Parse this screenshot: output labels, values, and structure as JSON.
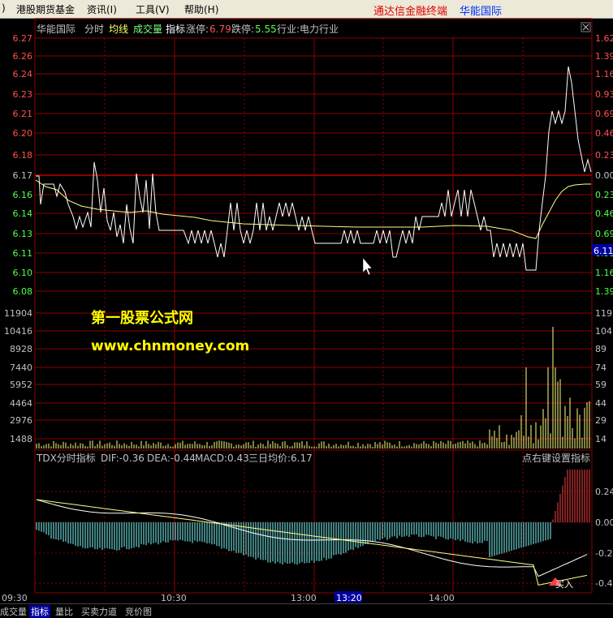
{
  "menubar": {
    "items": [
      "港股期货基金",
      "资讯(I)",
      "工具(V)",
      "帮助(H)"
    ],
    "left_fragment": ")",
    "app_title": "通达信金融终端",
    "stock_title": "华能国际"
  },
  "header": {
    "stock": "华能国际",
    "tabs": [
      "分时",
      "均线",
      "成交量",
      "指标"
    ],
    "limit_up_label": "涨停:",
    "limit_up": "6.79",
    "limit_down_label": "跌停:",
    "limit_down": "5.55",
    "industry": "行业:电力行业",
    "close_icon": "close-icon"
  },
  "price_axis_left": [
    "6.27",
    "6.26",
    "6.24",
    "6.23",
    "6.21",
    "6.20",
    "6.18",
    "6.17",
    "6.16",
    "6.14",
    "6.13",
    "6.11",
    "6.10",
    "6.08"
  ],
  "price_axis_right": [
    "1.62",
    "1.39",
    "1.16",
    "0.93",
    "0.69",
    "0.46",
    "0.23",
    "0.00",
    "0.23",
    "0.46",
    "0.69",
    "0.93",
    "1.16",
    "1.39"
  ],
  "current_price_tag": "6.11",
  "volume_axis_left": [
    "11904",
    "10416",
    "8928",
    "7440",
    "5952",
    "4464",
    "2976",
    "1488"
  ],
  "volume_axis_right": [
    "119",
    "104",
    "89",
    "74",
    "59",
    "44",
    "29",
    "14"
  ],
  "watermark": {
    "line1": "第一股票公式网",
    "line2": "www.chnmoney.com"
  },
  "indicator": {
    "title": "TDX分时指标",
    "dif": "DIF:-0.36",
    "dea": "DEA:-0.44",
    "macd": "MACD:0.43",
    "avg3": "三日均价:6.17",
    "hint": "点右键设置指标",
    "axis_right": [
      "0.24",
      "0.00",
      "-0.2",
      "-0.4"
    ],
    "buy_label": "买入"
  },
  "time_axis": [
    "09:30",
    "10:30",
    "13:00",
    "13:20",
    "14:00"
  ],
  "bottom_tabs": [
    "成交量",
    "指标",
    "量比",
    "买卖力道",
    "竞价图"
  ],
  "colors": {
    "background": "#000000",
    "grid": "#8b0000",
    "price_line": "#ffffff",
    "avg_line": "#ffff80",
    "up_text": "#ff5050",
    "down_text": "#50ff50",
    "macd_negative": "#80ffff",
    "macd_positive": "#ff4040",
    "watermark": "#ffff00"
  }
}
